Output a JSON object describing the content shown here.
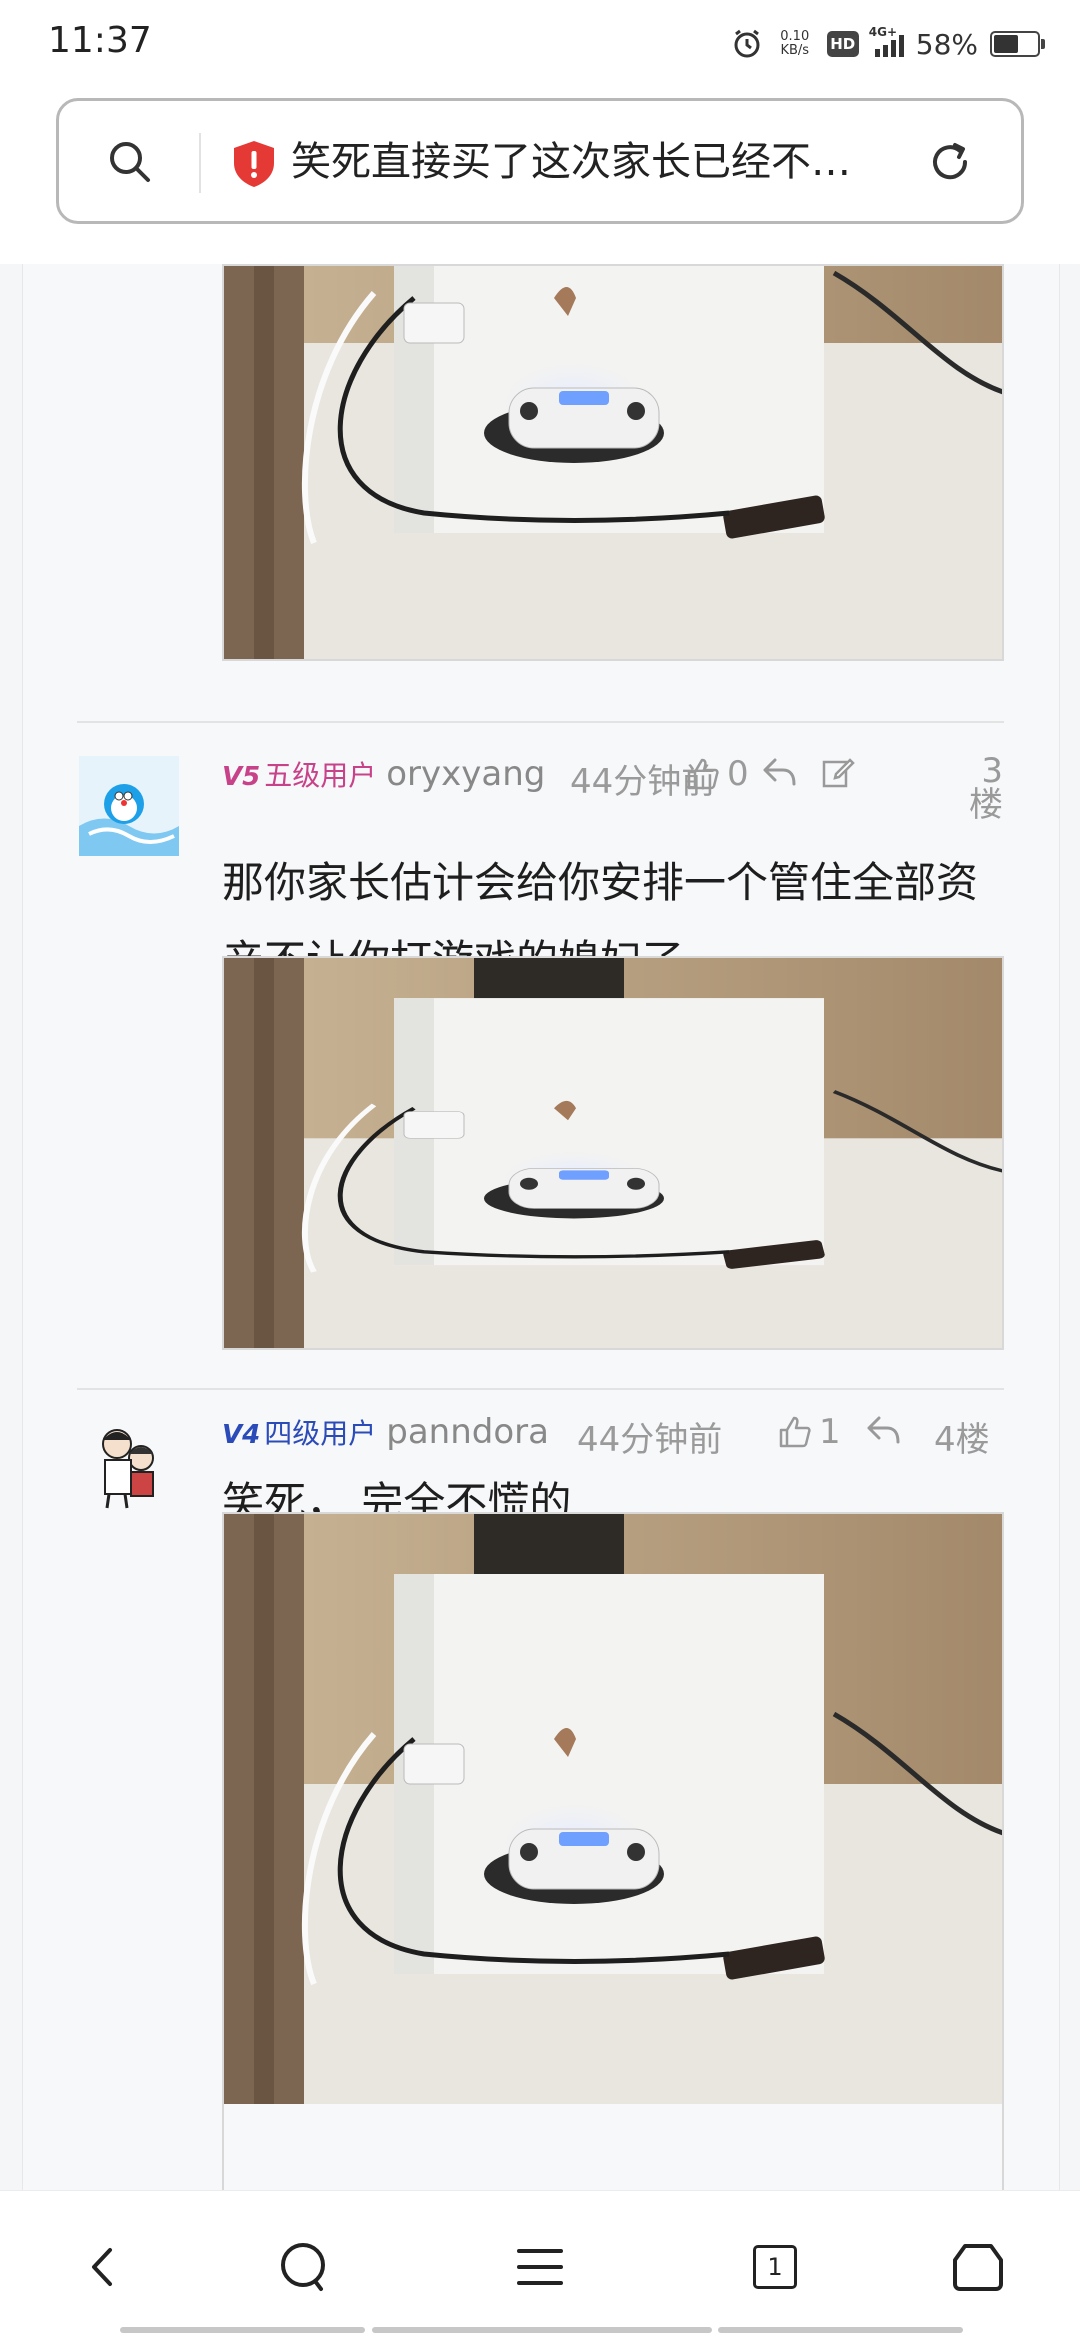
{
  "status_bar": {
    "time": "11:37",
    "net_speed_value": "0.10",
    "net_speed_unit": "KB/s",
    "hd": "HD",
    "network": "4G+",
    "battery_text": "58%",
    "battery_level": 0.58,
    "icons": [
      "alarm-icon",
      "hd-icon",
      "signal-icon",
      "battery-icon"
    ]
  },
  "address_bar": {
    "title": "笑死直接买了这次家长已经不让玩了吗",
    "icons": [
      "search-icon",
      "security-warning-icon",
      "refresh-icon"
    ],
    "warning_color": "#e53935"
  },
  "posts": [
    {
      "level_badge": "V5",
      "level_name": "五级用户",
      "level_color": "#c8428a",
      "username": "oryxyang",
      "time": "44分钟前",
      "likes": "0",
      "floor": "3楼",
      "text": "那你家长估计会给你安排一个管住全部资产不让你打游戏的媳妇了。。",
      "avatar": "doraemon-avatar"
    },
    {
      "level_badge": "V4",
      "level_name": "四级用户",
      "level_color": "#2b4bb8",
      "username": "panndora",
      "time": "44分钟前",
      "likes": "1",
      "floor": "4楼",
      "text": "笑死， 完全不慌的",
      "avatar": "cartoon-avatar"
    }
  ],
  "images": {
    "subject": "white-ps4-pro-with-controller-photo",
    "accent_brown": "#a57a5a"
  },
  "bottom_nav": {
    "tab_count": "1",
    "items": [
      "back-icon",
      "search-icon",
      "menu-icon",
      "tabs-icon",
      "home-icon"
    ]
  }
}
